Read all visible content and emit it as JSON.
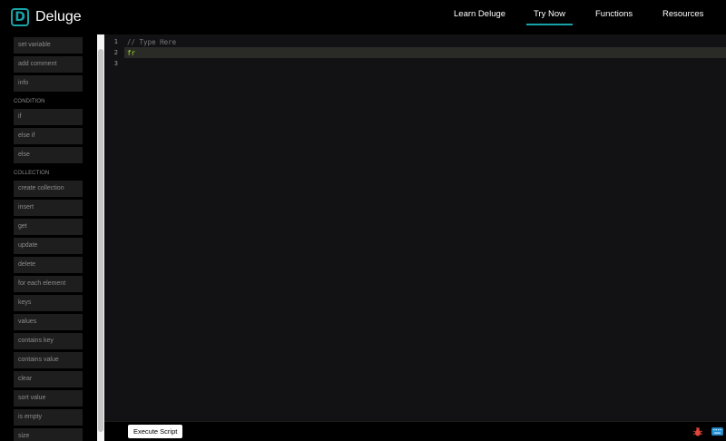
{
  "header": {
    "logo_letter": "D",
    "logo_text": "Deluge",
    "nav": [
      {
        "label": "Learn Deluge"
      },
      {
        "label": "Try Now"
      },
      {
        "label": "Functions"
      },
      {
        "label": "Resources"
      }
    ],
    "active_nav": "Try Now",
    "accent_color": "#18a3a9"
  },
  "sidebar": {
    "items_top": [
      "set variable",
      "add comment",
      "info"
    ],
    "section_condition": "CONDITION",
    "items_condition": [
      "if",
      "else if",
      "else"
    ],
    "section_collection": "COLLECTION",
    "items_collection": [
      "create collection",
      "insert",
      "get",
      "update",
      "delete",
      "for each element",
      "keys",
      "values",
      "contains key",
      "contains value",
      "clear",
      "sort value",
      "is empty",
      "size"
    ]
  },
  "editor": {
    "line_numbers": [
      "1",
      "2",
      "3"
    ],
    "lines": [
      "// Type Here",
      "fr",
      ""
    ],
    "active_line": 2
  },
  "bottombar": {
    "execute_label": "Execute Script",
    "icons": [
      "bug-icon",
      "keyboard-icon"
    ]
  }
}
